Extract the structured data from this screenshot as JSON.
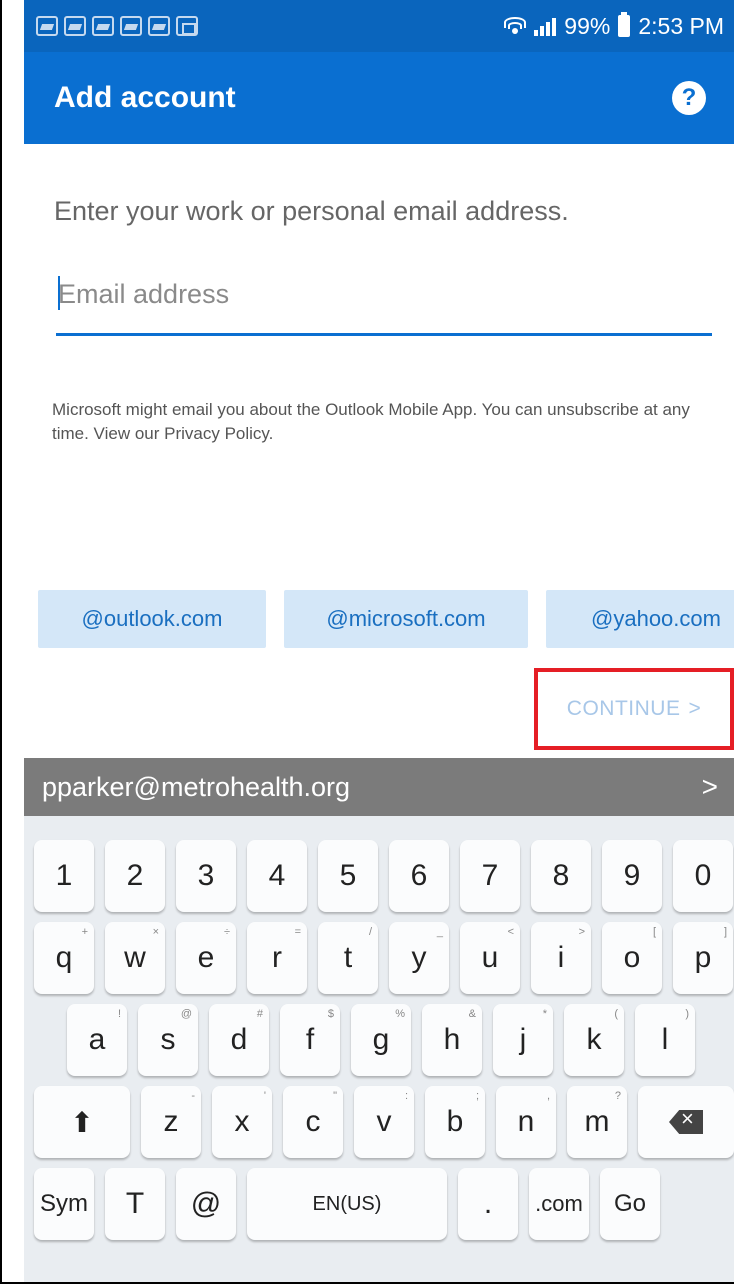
{
  "status": {
    "battery_percent": "99%",
    "time": "2:53 PM",
    "notification_icons": [
      "notification-icon",
      "notification-icon",
      "notification-icon",
      "notification-icon",
      "notification-icon",
      "gallery-icon"
    ]
  },
  "app_bar": {
    "title": "Add account",
    "help_icon": "?"
  },
  "form": {
    "prompt": "Enter your work or personal email address.",
    "email_placeholder": "Email address",
    "email_value": "",
    "disclaimer": "Microsoft might email you about the Outlook Mobile App. You can unsubscribe at any time. View our Privacy Policy."
  },
  "domain_chips": [
    "@outlook.com",
    "@microsoft.com",
    "@yahoo.com"
  ],
  "continue": {
    "label": "CONTINUE",
    "arrow": ">"
  },
  "keyboard": {
    "suggestion": "pparker@metrohealth.org",
    "suggestion_arrow": ">",
    "row_numbers": [
      "1",
      "2",
      "3",
      "4",
      "5",
      "6",
      "7",
      "8",
      "9",
      "0"
    ],
    "row_q": [
      "q",
      "w",
      "e",
      "r",
      "t",
      "y",
      "u",
      "i",
      "o",
      "p"
    ],
    "row_q_sub": [
      "+",
      "×",
      "÷",
      "=",
      "/",
      "_",
      "<",
      ">",
      "[",
      "]"
    ],
    "row_a": [
      "a",
      "s",
      "d",
      "f",
      "g",
      "h",
      "j",
      "k",
      "l"
    ],
    "row_a_sub": [
      "!",
      "@",
      "#",
      "$",
      "%",
      "&",
      "*",
      "(",
      ")"
    ],
    "row_z": [
      "z",
      "x",
      "c",
      "v",
      "b",
      "n",
      "m"
    ],
    "row_z_sub": [
      "-",
      "'",
      "\"",
      ":",
      ";",
      ",",
      "?"
    ],
    "sym": "Sym",
    "tool": "T",
    "at": "@",
    "space": "EN(US)",
    "period": ".",
    "dotcom": ".com",
    "go": "Go"
  },
  "colors": {
    "accent": "#0a6fd1",
    "status_bar": "#0a65bd",
    "chip_bg": "#d4e7f8",
    "highlight": "#e51e25"
  }
}
